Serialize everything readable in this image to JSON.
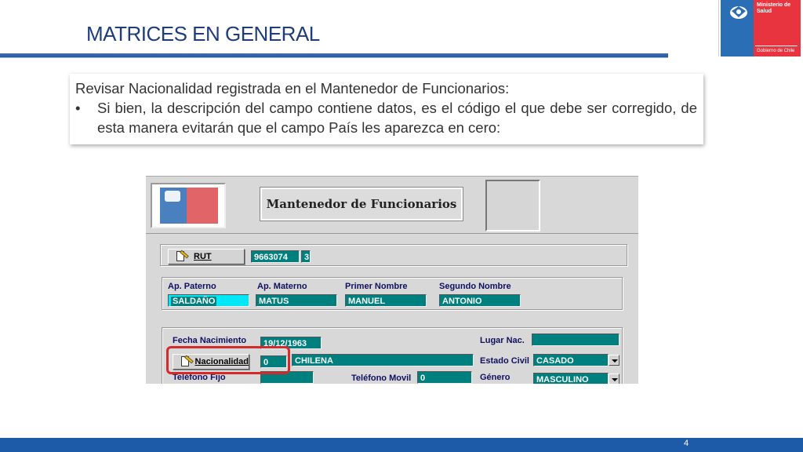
{
  "slide": {
    "title": "MATRICES EN GENERAL",
    "page_number": "4"
  },
  "logo": {
    "ministry": "Ministerio de\nSalud",
    "government": "Gobierno de Chile"
  },
  "textbox": {
    "intro": "Revisar Nacionalidad registrada en el Mantenedor de Funcionarios:",
    "bullet_symbol": "•",
    "bullet": "Si bien, la descripción del campo contiene datos, es el código el que debe ser corregido, de esta manera evitarán que el campo País les aparezca en cero:"
  },
  "app": {
    "title": "Mantenedor de Funcionarios",
    "rut_button": "RUT",
    "rut_value": "9663074",
    "rut_dv": "3",
    "labels": {
      "ap_paterno": "Ap. Paterno",
      "ap_materno": "Ap. Materno",
      "primer_nombre": "Primer Nombre",
      "segundo_nombre": "Segundo Nombre",
      "fecha_nacimiento": "Fecha Nacimiento",
      "lugar_nac": "Lugar Nac.",
      "estado_civil": "Estado Civil",
      "telefono_fijo": "Teléfono Fijo",
      "telefono_movil": "Teléfono Movil",
      "genero": "Género"
    },
    "values": {
      "ap_paterno": "SALDAÑO",
      "ap_materno": "MATUS",
      "primer_nombre": "MANUEL",
      "segundo_nombre": "ANTONIO",
      "fecha_nacimiento": "19/12/1963",
      "lugar_nac": "",
      "nacionalidad_codigo": "0",
      "nacionalidad_desc": "CHILENA",
      "estado_civil": "CASADO",
      "telefono_fijo": "",
      "telefono_movil": "0",
      "genero": "MASCULINO"
    },
    "nacionalidad_button": "Nacionalidad",
    "colors": {
      "field_bg": "#007f7f",
      "highlight": "#d42a2a"
    }
  }
}
